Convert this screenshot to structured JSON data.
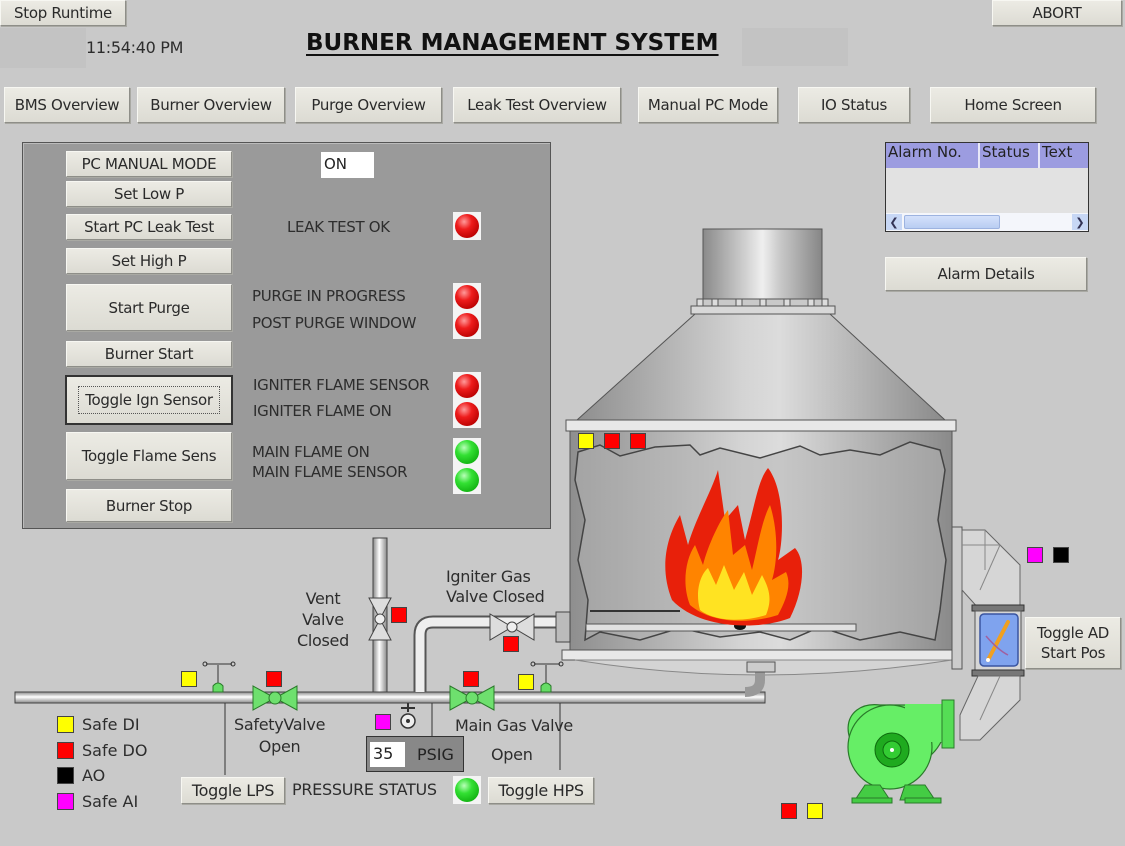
{
  "header": {
    "title": "BURNER  MANAGEMENT SYSTEM",
    "clock": "11:54:40 PM",
    "stop_runtime_label": "Stop Runtime",
    "abort_label": "ABORT"
  },
  "nav": [
    {
      "label": "BMS Overview"
    },
    {
      "label": "Burner Overview"
    },
    {
      "label": "Purge Overview"
    },
    {
      "label": "Leak Test Overview"
    },
    {
      "label": "Manual PC Mode"
    },
    {
      "label": "IO  Status"
    },
    {
      "label": "Home Screen"
    }
  ],
  "control_panel": {
    "buttons": {
      "pc_manual_mode": "PC MANUAL MODE",
      "set_low_p": "Set Low P",
      "start_pc_leak_test": "Start PC Leak Test",
      "set_high_p": "Set High P",
      "start_purge": "Start Purge",
      "burner_start": "Burner Start",
      "toggle_ign_sensor": "Toggle Ign Sensor",
      "toggle_flame_sens": "Toggle Flame Sens",
      "burner_stop": "Burner Stop"
    },
    "mode_value": "ON",
    "indicators": [
      {
        "label": "LEAK TEST OK",
        "state": "red"
      },
      {
        "label": "PURGE IN PROGRESS",
        "state": "red"
      },
      {
        "label": "POST PURGE WINDOW",
        "state": "red"
      },
      {
        "label": "IGNITER FLAME SENSOR",
        "state": "red"
      },
      {
        "label": "IGNITER FLAME ON",
        "state": "red"
      },
      {
        "label": "MAIN FLAME ON",
        "state": "green"
      },
      {
        "label": "MAIN FLAME SENSOR",
        "state": "green"
      }
    ]
  },
  "alarms": {
    "columns": [
      "Alarm No.",
      "Status",
      "Text"
    ],
    "rows": [],
    "details_label": "Alarm Details"
  },
  "process": {
    "vent_valve": {
      "line1": "Vent",
      "line2": "Valve",
      "line3": "Closed"
    },
    "igniter_valve": {
      "line1": "Igniter Gas",
      "line2": "Valve Closed"
    },
    "safety_valve": {
      "line1": "SafetyValve",
      "line2": "Open"
    },
    "main_gas_valve": {
      "line1": "Main Gas Valve",
      "line2": "Open"
    },
    "pressure": {
      "value": "35",
      "unit": "PSIG",
      "status_label": "PRESSURE STATUS",
      "status": "green"
    },
    "toggle_lps_label": "Toggle LPS",
    "toggle_hps_label": "Toggle HPS",
    "toggle_ad_label_1": "Toggle AD",
    "toggle_ad_label_2": "Start Pos"
  },
  "legend": [
    {
      "label": "Safe DI",
      "color": "#ffff00"
    },
    {
      "label": "Safe DO",
      "color": "#ff0000"
    },
    {
      "label": "AO",
      "color": "#000000"
    },
    {
      "label": "Safe AI",
      "color": "#ff00ff"
    }
  ],
  "colors": {
    "safe_di": "#ffff00",
    "safe_do": "#ff0000",
    "ao": "#000000",
    "safe_ai": "#ff00ff",
    "valve_open": "#66e066",
    "lamp_red": "#e01010",
    "lamp_green": "#22dd22"
  }
}
